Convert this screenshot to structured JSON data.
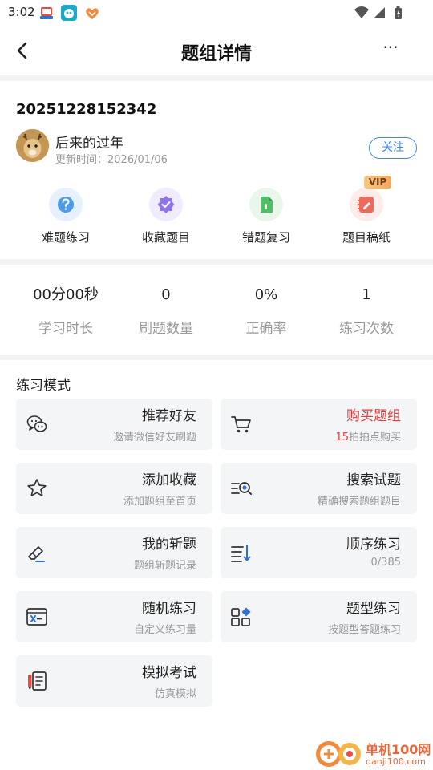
{
  "status_bar": {
    "time": "3:02",
    "apps": [
      "app-icon-1",
      "app-icon-2",
      "app-icon-3"
    ],
    "icons": [
      "wifi-icon",
      "signal-icon",
      "battery-icon"
    ]
  },
  "header": {
    "title": "题组详情",
    "more": "···"
  },
  "info": {
    "set_id": "20251228152342",
    "author": "后来的过年",
    "update_time": "更新时间：2026/01/06",
    "follow_label": "关注"
  },
  "tools": [
    {
      "label": "难题练习",
      "icon": "question-icon",
      "bg": "#e6f1fd",
      "color": "#4c9bf0"
    },
    {
      "label": "收藏题目",
      "icon": "collect-icon",
      "bg": "#efecfd",
      "color": "#8e74ee"
    },
    {
      "label": "错题复习",
      "icon": "wrong-book-icon",
      "bg": "#e9f6ea",
      "color": "#4fbf63"
    },
    {
      "label": "题目稿纸",
      "icon": "draft-icon",
      "bg": "#fdecea",
      "color": "#ef6a5b",
      "badge": "VIP"
    }
  ],
  "stats": [
    {
      "value": "00分00秒",
      "label": "学习时长"
    },
    {
      "value": "0",
      "label": "刷题数量"
    },
    {
      "value": "0%",
      "label": "正确率"
    },
    {
      "value": "1",
      "label": "练习次数"
    }
  ],
  "section_title": "练习模式",
  "modes": [
    {
      "name": "推荐好友",
      "desc": "邀请微信好友刷题",
      "icon": "wechat-icon"
    },
    {
      "name": "购买题组",
      "desc_highlight": "15",
      "desc": "拍拍点购买",
      "icon": "cart-icon"
    },
    {
      "name": "添加收藏",
      "desc": "添加题组至首页",
      "icon": "star-icon"
    },
    {
      "name": "搜索试题",
      "desc": "精确搜索题组题目",
      "icon": "search-list-icon"
    },
    {
      "name": "我的斩题",
      "desc": "题组斩题记录",
      "icon": "eraser-icon"
    },
    {
      "name": "顺序练习",
      "desc": "0/385",
      "icon": "sort-icon"
    },
    {
      "name": "随机练习",
      "desc": "自定义练习量",
      "icon": "shuffle-icon"
    },
    {
      "name": "题型练习",
      "desc": "按题型答题练习",
      "icon": "category-icon"
    },
    {
      "name": "模拟考试",
      "desc": "仿真模拟",
      "icon": "exam-icon"
    }
  ],
  "watermark": {
    "name": "单机100网",
    "url": "danji100.com"
  },
  "colors": {
    "accent": "#3a86f5",
    "highlight": "#e23c3c",
    "card_bg": "#f4f5f7",
    "divider": "#f2f3f5"
  }
}
